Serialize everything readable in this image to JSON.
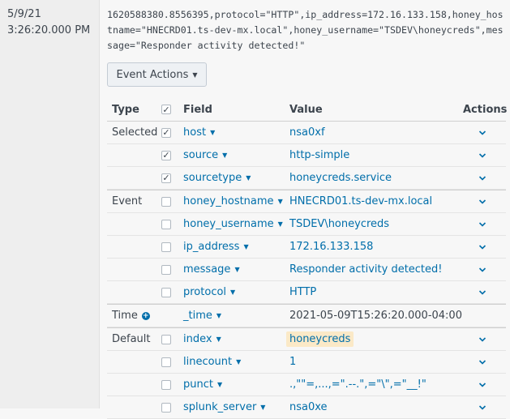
{
  "event": {
    "date": "5/9/21",
    "time": "3:26:20.000 PM",
    "raw": "1620588380.8556395,protocol=\"HTTP\",ip_address=172.16.133.158,honey_hostname=\"HNECRD01.ts-dev-mx.local\",honey_username=\"TSDEV\\honeycreds\",message=\"Responder activity detected!\"",
    "actions_button": "Event Actions"
  },
  "table": {
    "headers": {
      "type": "Type",
      "field": "Field",
      "value": "Value",
      "actions": "Actions"
    },
    "rows": [
      {
        "type": "Selected",
        "checked": true,
        "field": "host",
        "value": "nsa0xf"
      },
      {
        "type": "",
        "checked": true,
        "field": "source",
        "value": "http-simple"
      },
      {
        "type": "",
        "checked": true,
        "field": "sourcetype",
        "value": "honeycreds.service"
      },
      {
        "type": "Event",
        "checked": false,
        "field": "honey_hostname",
        "value": "HNECRD01.ts-dev-mx.local"
      },
      {
        "type": "",
        "checked": false,
        "field": "honey_username",
        "value": "TSDEV\\honeycreds"
      },
      {
        "type": "",
        "checked": false,
        "field": "ip_address",
        "value": "172.16.133.158"
      },
      {
        "type": "",
        "checked": false,
        "field": "message",
        "value": "Responder activity detected!"
      },
      {
        "type": "",
        "checked": false,
        "field": "protocol",
        "value": "HTTP"
      },
      {
        "type": "Time",
        "field": "_time",
        "value": "2021-05-09T15:26:20.000-04:00"
      },
      {
        "type": "Default",
        "checked": false,
        "field": "index",
        "value": "honeycreds"
      },
      {
        "type": "",
        "checked": false,
        "field": "linecount",
        "value": "1"
      },
      {
        "type": "",
        "checked": false,
        "field": "punct",
        "value": ".,\"\"=,...,=\".--.\",=\"\\\",=\"__!\""
      },
      {
        "type": "",
        "checked": false,
        "field": "splunk_server",
        "value": "nsa0xe"
      }
    ]
  },
  "colors": {
    "link": "#006eaa",
    "highlight": "#fbe9c7"
  }
}
